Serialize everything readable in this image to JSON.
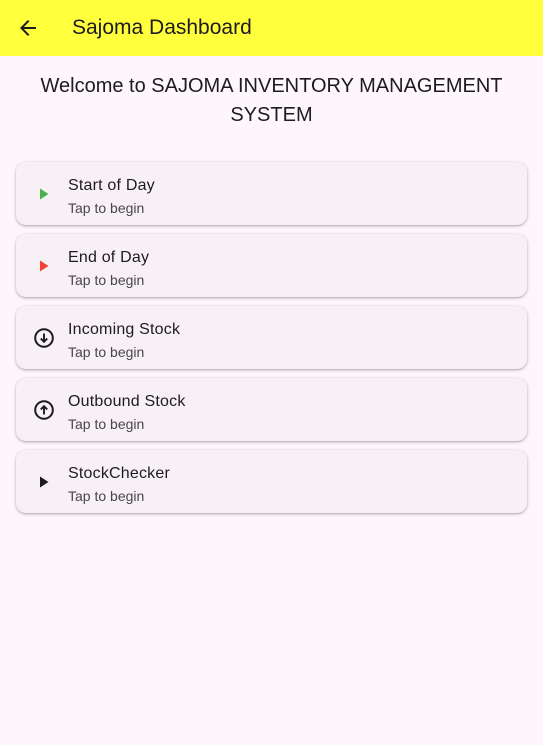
{
  "appbar": {
    "title": "Sajoma Dashboard",
    "back_icon": "arrow-left-icon",
    "background": "#ffff3b"
  },
  "welcome": "Welcome to SAJOMA INVENTORY MANAGEMENT SYSTEM",
  "items": [
    {
      "title": "Start of Day",
      "subtitle": "Tap to begin",
      "icon": "play-icon",
      "color": "#4caf50"
    },
    {
      "title": "End of Day",
      "subtitle": "Tap to begin",
      "icon": "play-icon",
      "color": "#f44336"
    },
    {
      "title": "Incoming Stock",
      "subtitle": "Tap to begin",
      "icon": "arrow-circle-down-icon",
      "color": "#1d1b20"
    },
    {
      "title": "Outbound Stock",
      "subtitle": "Tap to begin",
      "icon": "arrow-circle-up-icon",
      "color": "#1d1b20"
    },
    {
      "title": "StockChecker",
      "subtitle": "Tap to begin",
      "icon": "play-icon",
      "color": "#1d1b20"
    }
  ]
}
